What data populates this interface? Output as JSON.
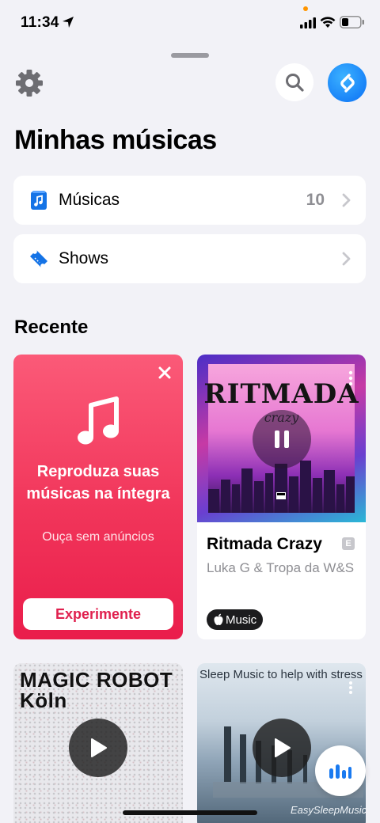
{
  "status_bar": {
    "time": "11:34"
  },
  "header": {
    "title": "Minhas músicas"
  },
  "library": {
    "songs": {
      "label": "Músicas",
      "count": "10"
    },
    "shows": {
      "label": "Shows"
    }
  },
  "recent": {
    "title": "Recente",
    "promo": {
      "headline": "Reproduza suas músicas na íntegra",
      "subtitle": "Ouça sem anúncios",
      "cta": "Experimente"
    },
    "track": {
      "cover_title": "RITMADA",
      "cover_subtitle": "crazy",
      "title": "Ritmada Crazy",
      "explicit": "E",
      "artist": "Luka G & Tropa da W&S",
      "badge": "Music"
    },
    "card3": {
      "cover_text": "MAGIC ROBOT Köln"
    },
    "card4": {
      "cover_text": "Sleep Music to help with stress",
      "brand": "EasySleepMusic"
    }
  },
  "colors": {
    "accent": "#0a6ff5",
    "promo": "#f1355a",
    "cta_text": "#e0204e"
  },
  "icons": [
    "location-arrow-icon",
    "signal-icon",
    "wifi-icon",
    "battery-icon",
    "gear-icon",
    "search-icon",
    "shazam-icon",
    "music-note-icon",
    "ticket-icon",
    "chevron-right-icon",
    "close-icon",
    "pause-icon",
    "more-icon",
    "apple-icon",
    "play-icon",
    "equalizer-icon"
  ]
}
